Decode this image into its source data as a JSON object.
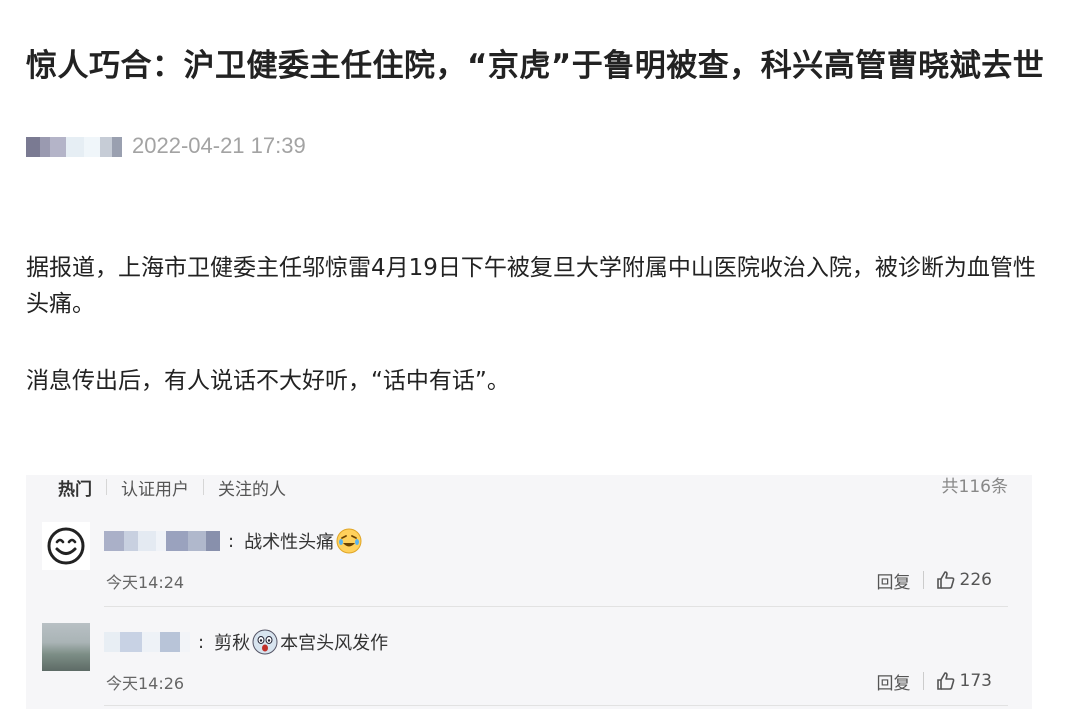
{
  "article": {
    "title": "惊人巧合：沪卫健委主任住院，“京虎”于鲁明被查，科兴高管曹晓斌去世",
    "date": "2022-04-21 17:39",
    "paragraphs": [
      "据报道，上海市卫健委主任邬惊雷4月19日下午被复旦大学附属中山医院收治入院，被诊断为血管性头痛。",
      "消息传出后，有人说话不大好听，“话中有话”。"
    ]
  },
  "comments": {
    "tabs": [
      "热门",
      "认证用户",
      "关注的人"
    ],
    "active_tab": "热门",
    "total": "共116条",
    "items": [
      {
        "text_parts": [
          "战术性头痛"
        ],
        "emoji": [
          "laugh-cry-emoji"
        ],
        "time": "今天14:24",
        "reply": "回复",
        "likes": "226",
        "avatar": "smiley-face-icon"
      },
      {
        "text_parts": [
          "剪秋",
          "本宫头风发作"
        ],
        "emoji": [
          "panic-emoji"
        ],
        "time": "今天14:26",
        "reply": "回复",
        "likes": "173",
        "avatar": "landscape-photo"
      }
    ]
  }
}
